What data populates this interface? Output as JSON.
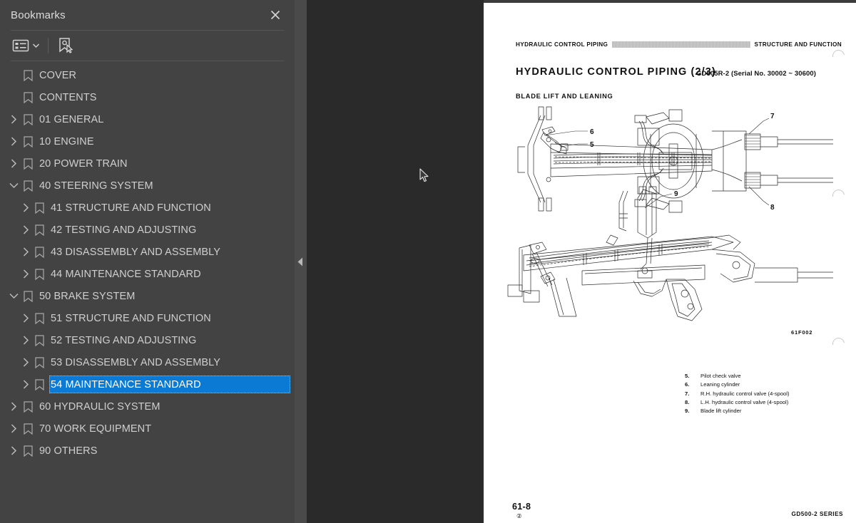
{
  "sidebar": {
    "title": "Bookmarks",
    "close_icon": "close-icon",
    "toolbar": {
      "options_icon": "list-options-icon",
      "caret_icon": "chevron-down-icon",
      "expand_bookmark_icon": "bookmark-cursor-icon"
    },
    "items": [
      {
        "label": "COVER",
        "depth": 0,
        "state": "leaf"
      },
      {
        "label": "CONTENTS",
        "depth": 0,
        "state": "leaf"
      },
      {
        "label": "01 GENERAL",
        "depth": 0,
        "state": "collapsed"
      },
      {
        "label": "10 ENGINE",
        "depth": 0,
        "state": "collapsed"
      },
      {
        "label": "20 POWER TRAIN",
        "depth": 0,
        "state": "collapsed"
      },
      {
        "label": "40 STEERING SYSTEM",
        "depth": 0,
        "state": "expanded"
      },
      {
        "label": "41 STRUCTURE AND FUNCTION",
        "depth": 1,
        "state": "collapsed"
      },
      {
        "label": "42 TESTING AND ADJUSTING",
        "depth": 1,
        "state": "collapsed"
      },
      {
        "label": "43 DISASSEMBLY AND ASSEMBLY",
        "depth": 1,
        "state": "collapsed"
      },
      {
        "label": "44 MAINTENANCE STANDARD",
        "depth": 1,
        "state": "collapsed"
      },
      {
        "label": "50 BRAKE SYSTEM",
        "depth": 0,
        "state": "expanded"
      },
      {
        "label": "51 STRUCTURE AND FUNCTION",
        "depth": 1,
        "state": "collapsed"
      },
      {
        "label": "52 TESTING AND ADJUSTING",
        "depth": 1,
        "state": "collapsed"
      },
      {
        "label": "53 DISASSEMBLY AND ASSEMBLY",
        "depth": 1,
        "state": "collapsed"
      },
      {
        "label": "54 MAINTENANCE STANDARD",
        "depth": 1,
        "state": "collapsed",
        "selected": true
      },
      {
        "label": "60 HYDRAULIC SYSTEM",
        "depth": 0,
        "state": "collapsed"
      },
      {
        "label": "70 WORK EQUIPMENT",
        "depth": 0,
        "state": "collapsed"
      },
      {
        "label": "90 OTHERS",
        "depth": 0,
        "state": "collapsed"
      }
    ],
    "selection_color": "#0b7ad5"
  },
  "splitter": {
    "collapse_icon": "collapse-left-icon"
  },
  "document": {
    "header_left": "HYDRAULIC CONTROL PIPING",
    "header_right": "STRUCTURE AND FUNCTION",
    "title": "HYDRAULIC  CONTROL  PIPING  (2/3)",
    "model": "GD505R-2 (Serial No. 30002 ~ 30600)",
    "subtitle": "BLADE LIFT AND LEANING",
    "figure_code": "61F002",
    "legend": [
      {
        "num": "5.",
        "text": "Pilot check valve"
      },
      {
        "num": "6.",
        "text": "Leaning cylinder"
      },
      {
        "num": "7.",
        "text": "R.H. hydraulic control valve (4-spool)"
      },
      {
        "num": "8.",
        "text": "L.H. hydraulic control valve (4-spool)"
      },
      {
        "num": "9.",
        "text": "Blade lift cylinder"
      }
    ],
    "callouts": [
      "5",
      "6",
      "7",
      "8",
      "9"
    ],
    "footer_page": "61-8",
    "footer_page_sub": "②",
    "footer_series": "GD500-2 SERIES"
  }
}
